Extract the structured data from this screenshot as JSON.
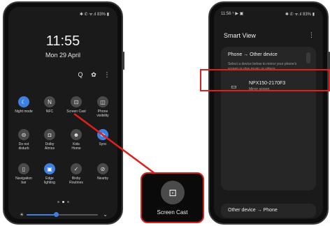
{
  "phone_left": {
    "status": "✱ ✆ ᯤ.ıl 83% ▮",
    "clock": "11:55",
    "date": "Mon 29 April",
    "top_icons": [
      "search-icon",
      "gear-icon",
      "more-vert-icon"
    ],
    "top_icon_glyphs": [
      "Q",
      "✿",
      "⋮"
    ],
    "tiles": [
      {
        "label": "Night mode",
        "glyph": "☾",
        "on": true
      },
      {
        "label": "NFC",
        "glyph": "N",
        "on": false
      },
      {
        "label": "Screen Cast",
        "glyph": "⊡",
        "on": false
      },
      {
        "label": "Phone\nvisibility",
        "glyph": "◫",
        "on": false
      },
      {
        "label": "Do not\ndisturb",
        "glyph": "⊖",
        "on": false
      },
      {
        "label": "Dolby\nAtmos",
        "glyph": "◘",
        "on": false
      },
      {
        "label": "Kids\nHome",
        "glyph": "☻",
        "on": false
      },
      {
        "label": "Sync",
        "glyph": "⟳",
        "on": true
      },
      {
        "label": "Navigation\nbar",
        "glyph": "▯",
        "on": false
      },
      {
        "label": "Edge\nlighting",
        "glyph": "▣",
        "on": true
      },
      {
        "label": "Bixby\nRoutines",
        "glyph": "✓",
        "on": false
      },
      {
        "label": "Nearby",
        "glyph": "⊘",
        "on": false
      }
    ],
    "brightness": 0.42
  },
  "zoom_callout": {
    "label": "Screen Cast",
    "glyph": "⊡"
  },
  "phone_right": {
    "status_left": "11:56 ⁵ ▶ ▣",
    "status": "✱ ✆ ᯤ.ıl 83% ▮",
    "title": "Smart View",
    "menu_glyph": "⋮",
    "card_heading": "Phone → Other device",
    "card_desc": "Select a device below to mirror your phone's screen or play music or videos.",
    "device": {
      "icon": "tv-icon",
      "glyph": "▭",
      "name": "NPX150-2170F3",
      "sub": "Mirror screen"
    },
    "bottom": "Other device → Phone"
  }
}
